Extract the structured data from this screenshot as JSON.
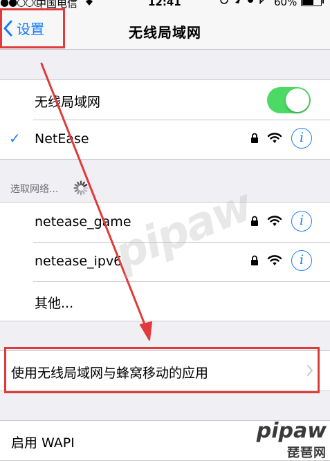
{
  "status_bar": {
    "signal": "●●○○○",
    "carrier": "中国电信",
    "time": "12:41",
    "battery_percent": "60%",
    "battery_level": 0.6
  },
  "nav": {
    "back_label": "设置",
    "title": "无线局域网"
  },
  "wifi_toggle": {
    "label": "无线局域网",
    "on": true
  },
  "connected_network": {
    "name": "NetEase",
    "secured": true
  },
  "choose_network_header": "选取网络...",
  "networks": [
    {
      "name": "netease_game",
      "secured": true
    },
    {
      "name": "netease_ipv6",
      "secured": true
    }
  ],
  "other_label": "其他...",
  "apps_using_wlan_label": "使用无线局域网与蜂窝移动的应用",
  "enable_wapi_label": "启用 WAPI",
  "watermark": {
    "text": "pipaw",
    "logo_en": "pipaw",
    "logo_cn": "琵琶网"
  },
  "colors": {
    "accent": "#157efb",
    "toggle_on": "#4cd964",
    "annotation_red": "#e03a3a",
    "background": "#efeff4"
  }
}
